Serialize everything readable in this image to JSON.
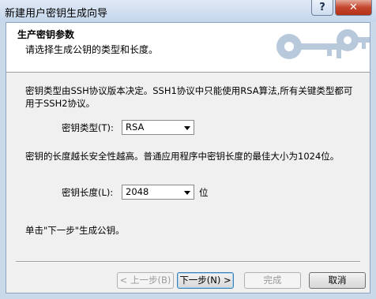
{
  "window": {
    "title": "新建用户密钥生成向导",
    "help_label": "?",
    "close_label": "✕"
  },
  "header": {
    "title": "生产密钥参数",
    "subtitle": "请选择生成公钥的类型和长度。"
  },
  "body": {
    "type_desc_line1": "密钥类型由SSH协议版本决定。SSH1协议中只能使用RSA算法,所有关键类型都可",
    "type_desc_line2": "用于SSH2协议。",
    "type_label": "密钥类型(T):",
    "type_value": "RSA",
    "length_desc": "密钥的长度越长安全性越高。普通应用程序中密钥长度的最佳大小为1024位。",
    "length_label": "密钥长度(L):",
    "length_value": "2048",
    "length_unit": "位",
    "instruction": "单击\"下一步\"生成公钥。"
  },
  "buttons": {
    "back": "< 上一步(B)",
    "next": "下一步(N) >",
    "finish": "完成",
    "cancel": "取消"
  },
  "colors": {
    "key_art": "#b9c9dc",
    "title_gradient_top": "#dfe9f5",
    "close_red": "#c3452c"
  }
}
